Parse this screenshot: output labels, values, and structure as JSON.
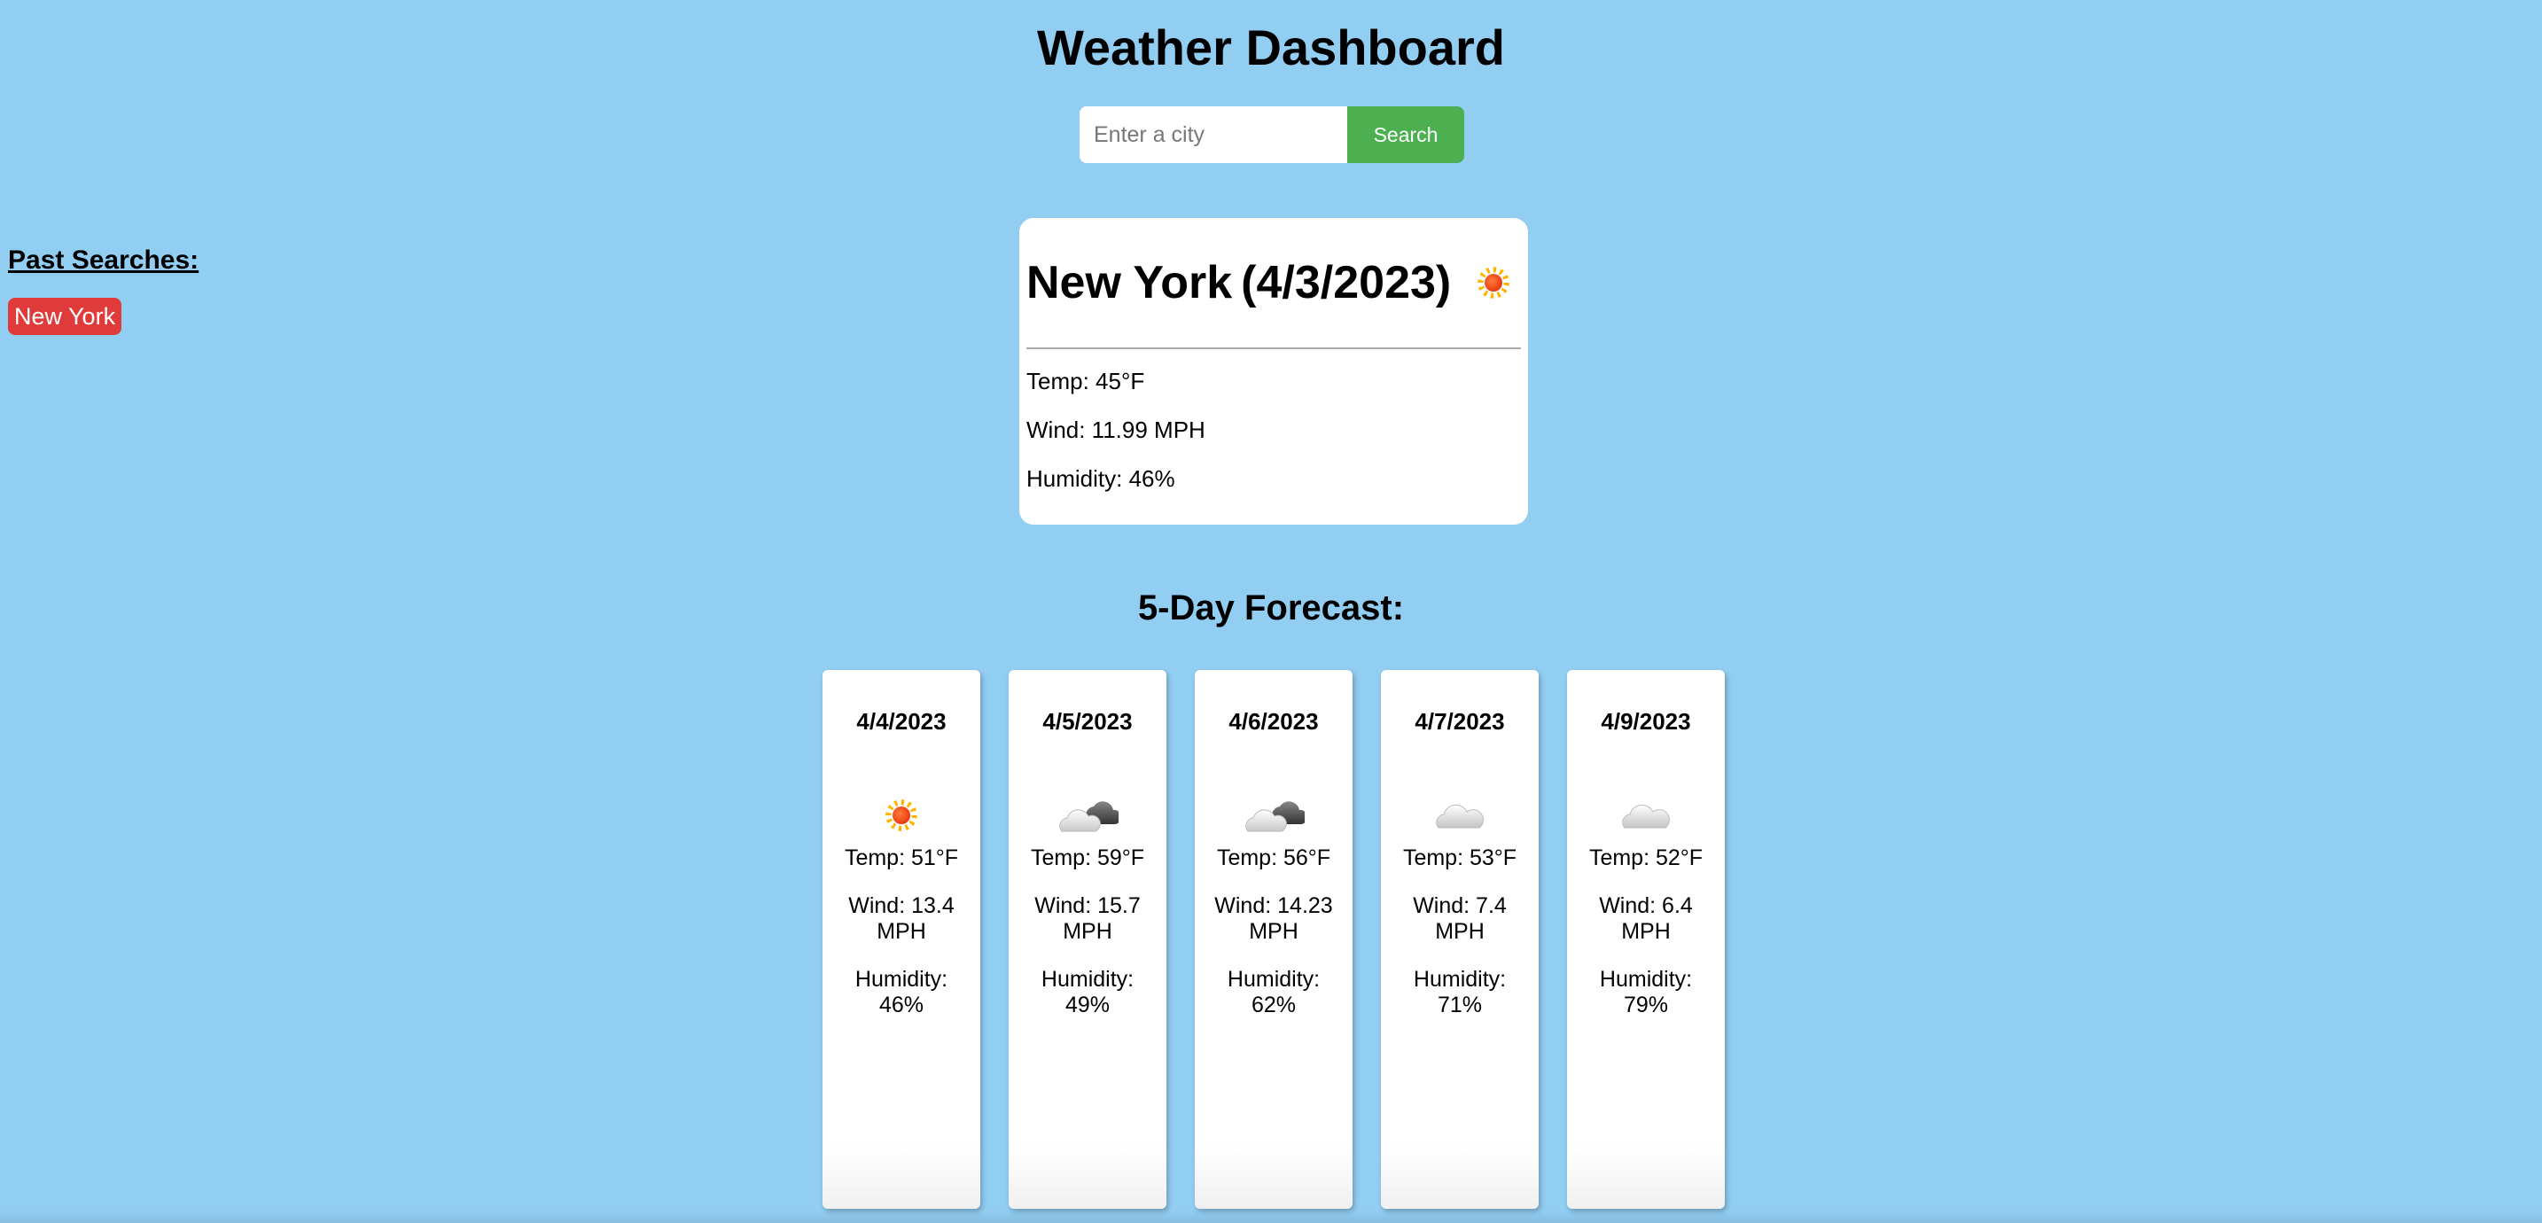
{
  "header": {
    "title": "Weather Dashboard"
  },
  "search": {
    "placeholder": "Enter a city",
    "value": "",
    "button_label": "Search"
  },
  "past_searches": {
    "heading": "Past Searches:",
    "items": [
      "New York"
    ]
  },
  "current": {
    "city": "New York",
    "date": "(4/3/2023)",
    "icon": "sun-icon",
    "temp": "Temp: 45°F",
    "wind": "Wind: 11.99 MPH",
    "humidity": "Humidity: 46%"
  },
  "forecast": {
    "heading": "5-Day Forecast:",
    "days": [
      {
        "date": "4/4/2023",
        "icon": "sun-icon",
        "temp": "Temp: 51°F",
        "wind": "Wind: 13.4 MPH",
        "humidity": "Humidity: 46%"
      },
      {
        "date": "4/5/2023",
        "icon": "partly-cloudy-icon",
        "temp": "Temp: 59°F",
        "wind": "Wind: 15.7 MPH",
        "humidity": "Humidity: 49%"
      },
      {
        "date": "4/6/2023",
        "icon": "partly-cloudy-icon",
        "temp": "Temp: 56°F",
        "wind": "Wind: 14.23 MPH",
        "humidity": "Humidity: 62%"
      },
      {
        "date": "4/7/2023",
        "icon": "cloud-icon",
        "temp": "Temp: 53°F",
        "wind": "Wind: 7.4 MPH",
        "humidity": "Humidity: 71%"
      },
      {
        "date": "4/9/2023",
        "icon": "cloud-icon",
        "temp": "Temp: 52°F",
        "wind": "Wind: 6.4 MPH",
        "humidity": "Humidity: 79%"
      }
    ]
  },
  "colors": {
    "background": "#92cdf2",
    "search_button": "#4caf50",
    "past_search_button": "#e03b3b"
  }
}
